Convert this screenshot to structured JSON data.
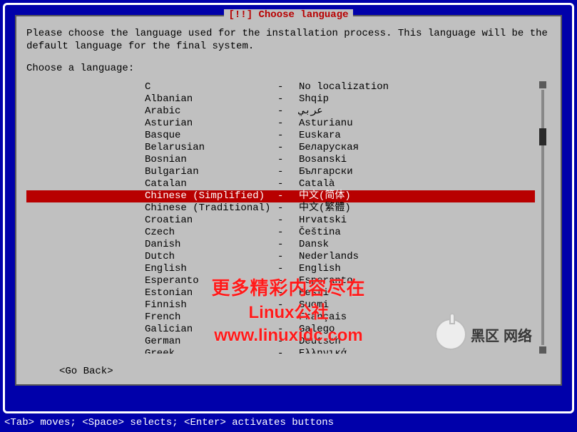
{
  "dialog": {
    "title": "[!!] Choose language",
    "intro": "Please choose the language used for the installation process. This language will be the default language for the final system.",
    "prompt": "Choose a language:",
    "go_back": "<Go Back>"
  },
  "languages": [
    {
      "name": "C",
      "sep": "-",
      "native": "No localization",
      "selected": false
    },
    {
      "name": "Albanian",
      "sep": "-",
      "native": "Shqip",
      "selected": false
    },
    {
      "name": "Arabic",
      "sep": "-",
      "native": "عربي",
      "selected": false
    },
    {
      "name": "Asturian",
      "sep": "-",
      "native": "Asturianu",
      "selected": false
    },
    {
      "name": "Basque",
      "sep": "-",
      "native": "Euskara",
      "selected": false
    },
    {
      "name": "Belarusian",
      "sep": "-",
      "native": "Беларуская",
      "selected": false
    },
    {
      "name": "Bosnian",
      "sep": "-",
      "native": "Bosanski",
      "selected": false
    },
    {
      "name": "Bulgarian",
      "sep": "-",
      "native": "Български",
      "selected": false
    },
    {
      "name": "Catalan",
      "sep": "-",
      "native": "Català",
      "selected": false
    },
    {
      "name": "Chinese (Simplified)",
      "sep": "-",
      "native": "中文(简体)",
      "selected": true
    },
    {
      "name": "Chinese (Traditional)",
      "sep": "-",
      "native": "中文(繁體)",
      "selected": false
    },
    {
      "name": "Croatian",
      "sep": "-",
      "native": "Hrvatski",
      "selected": false
    },
    {
      "name": "Czech",
      "sep": "-",
      "native": "Čeština",
      "selected": false
    },
    {
      "name": "Danish",
      "sep": "-",
      "native": "Dansk",
      "selected": false
    },
    {
      "name": "Dutch",
      "sep": "-",
      "native": "Nederlands",
      "selected": false
    },
    {
      "name": "English",
      "sep": "-",
      "native": "English",
      "selected": false
    },
    {
      "name": "Esperanto",
      "sep": "-",
      "native": "Esperanto",
      "selected": false
    },
    {
      "name": "Estonian",
      "sep": "-",
      "native": "Eesti",
      "selected": false
    },
    {
      "name": "Finnish",
      "sep": "-",
      "native": "Suomi",
      "selected": false
    },
    {
      "name": "French",
      "sep": "-",
      "native": "Français",
      "selected": false
    },
    {
      "name": "Galician",
      "sep": "-",
      "native": "Galego",
      "selected": false
    },
    {
      "name": "German",
      "sep": "-",
      "native": "Deutsch",
      "selected": false
    },
    {
      "name": "Greek",
      "sep": "-",
      "native": "Ελληνικά",
      "selected": false
    }
  ],
  "hint": "<Tab> moves; <Space> selects; <Enter> activates buttons",
  "watermark": {
    "line1": "更多精彩内容尽在",
    "line2": "Linux公社",
    "line3": "www.linuxidc.com",
    "badge1": "黑区",
    "badge2": "网络"
  }
}
